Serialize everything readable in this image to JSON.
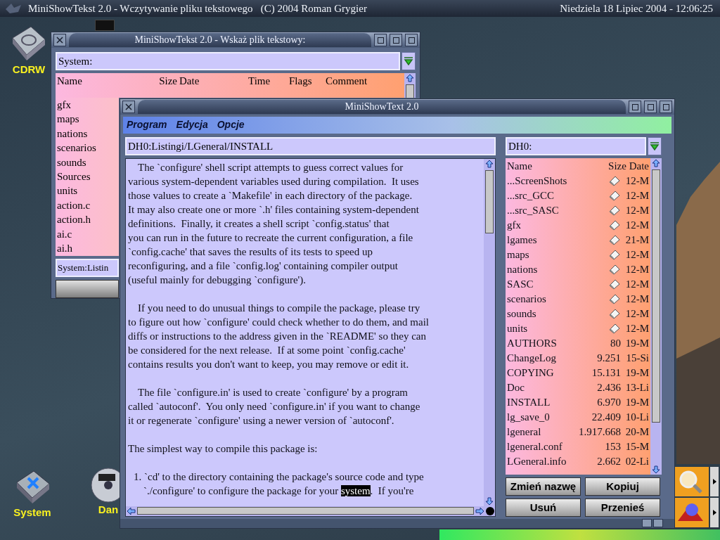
{
  "screen_bar": {
    "title": "MiniShowTekst 2.0 - Wczytywanie pliku tekstowego   (C) 2004 Roman Grygier",
    "datetime": "Niedziela 18 Lipiec 2004 - 12:06:25"
  },
  "desktop_icons": [
    {
      "label": "CDRW",
      "kind": "drive"
    },
    {
      "label": "System",
      "kind": "harddisk"
    },
    {
      "label": "Dan",
      "kind": "disc"
    }
  ],
  "file_requester": {
    "title": "MiniShowTekst 2.0 - Wskaż plik tekstowy:",
    "path": "System:",
    "columns": [
      "Name",
      "Size",
      "Date",
      "Time",
      "Flags",
      "Comment"
    ],
    "rows": [
      "gfx",
      "maps",
      "nations",
      "scenarios",
      "sounds",
      "Sources",
      "units",
      "action.c",
      "action.h",
      "ai.c",
      "ai.h"
    ],
    "file_field": "System:Listin"
  },
  "viewer": {
    "title": "MiniShowText 2.0",
    "menu": [
      "Program",
      "Edycja",
      "Opcje"
    ],
    "path": "DH0:Listingi/LGeneral/INSTALL",
    "paragraphs": [
      {
        "kind": "indented",
        "lines": [
          "The `configure' shell script attempts to guess correct values for",
          "various system-dependent variables used during compilation.  It uses",
          "those values to create a `Makefile' in each directory of the package.",
          "It may also create one or more `.h' files containing system-dependent",
          "definitions.  Finally, it creates a shell script `config.status' that",
          "you can run in the future to recreate the current configuration, a file",
          "`config.cache' that saves the results of its tests to speed up",
          "reconfiguring, and a file `config.log' containing compiler output",
          "(useful mainly for debugging `configure')."
        ]
      },
      {
        "kind": "indented",
        "lines": [
          "If you need to do unusual things to compile the package, please try",
          "to figure out how `configure' could check whether to do them, and mail",
          "diffs or instructions to the address given in the `README' so they can",
          "be considered for the next release.  If at some point `config.cache'",
          "contains results you don't want to keep, you may remove or edit it."
        ]
      },
      {
        "kind": "indented",
        "lines": [
          "The file `configure.in' is used to create `configure' by a program",
          "called `autoconf'.  You only need `configure.in' if you want to change",
          "it or regenerate `configure' using a newer version of `autoconf'."
        ]
      },
      {
        "kind": "plain",
        "lines": [
          "The simplest way to compile this package is:"
        ]
      },
      {
        "kind": "list",
        "lines": [
          "1. `cd' to the directory containing the package's source code and type",
          {
            "segments": [
              {
                "text": "`./configure' to configure the package for your ",
                "selected": false
              },
              {
                "text": "system",
                "selected": true
              },
              {
                "text": ".  If you're",
                "selected": false
              }
            ]
          }
        ]
      }
    ],
    "browser": {
      "path": "DH0:",
      "columns": [
        "Name",
        "Size Date"
      ],
      "rows": [
        {
          "name": "...ScreenShots",
          "kind": "drawer",
          "date": "12-M"
        },
        {
          "name": "...src_GCC",
          "kind": "drawer",
          "date": "12-M"
        },
        {
          "name": "...src_SASC",
          "kind": "drawer",
          "date": "12-M"
        },
        {
          "name": "gfx",
          "kind": "drawer",
          "date": "12-M"
        },
        {
          "name": "lgames",
          "kind": "drawer",
          "date": "21-M"
        },
        {
          "name": "maps",
          "kind": "drawer",
          "date": "12-M"
        },
        {
          "name": "nations",
          "kind": "drawer",
          "date": "12-M"
        },
        {
          "name": "SASC",
          "kind": "drawer",
          "date": "12-M"
        },
        {
          "name": "scenarios",
          "kind": "drawer",
          "date": "12-M"
        },
        {
          "name": "sounds",
          "kind": "drawer",
          "date": "12-M"
        },
        {
          "name": "units",
          "kind": "drawer",
          "date": "12-M"
        },
        {
          "name": "AUTHORS",
          "kind": "file",
          "size": "80",
          "date": "19-M"
        },
        {
          "name": "ChangeLog",
          "kind": "file",
          "size": "9.251",
          "date": "15-Si"
        },
        {
          "name": "COPYING",
          "kind": "file",
          "size": "15.131",
          "date": "19-M"
        },
        {
          "name": "Doc",
          "kind": "file",
          "size": "2.436",
          "date": "13-Li"
        },
        {
          "name": "INSTALL",
          "kind": "file",
          "size": "6.970",
          "date": "19-M"
        },
        {
          "name": "lg_save_0",
          "kind": "file",
          "size": "22.409",
          "date": "10-Li"
        },
        {
          "name": "lgeneral",
          "kind": "file",
          "size": "1.917.668",
          "date": "20-M"
        },
        {
          "name": "lgeneral.conf",
          "kind": "file",
          "size": "153",
          "date": "15-M"
        },
        {
          "name": "LGeneral.info",
          "kind": "file",
          "size": "2.662",
          "date": "02-Li"
        }
      ],
      "buttons": [
        "Zmień nazwę",
        "Kopiuj",
        "Usuń",
        "Przenieś"
      ]
    }
  }
}
